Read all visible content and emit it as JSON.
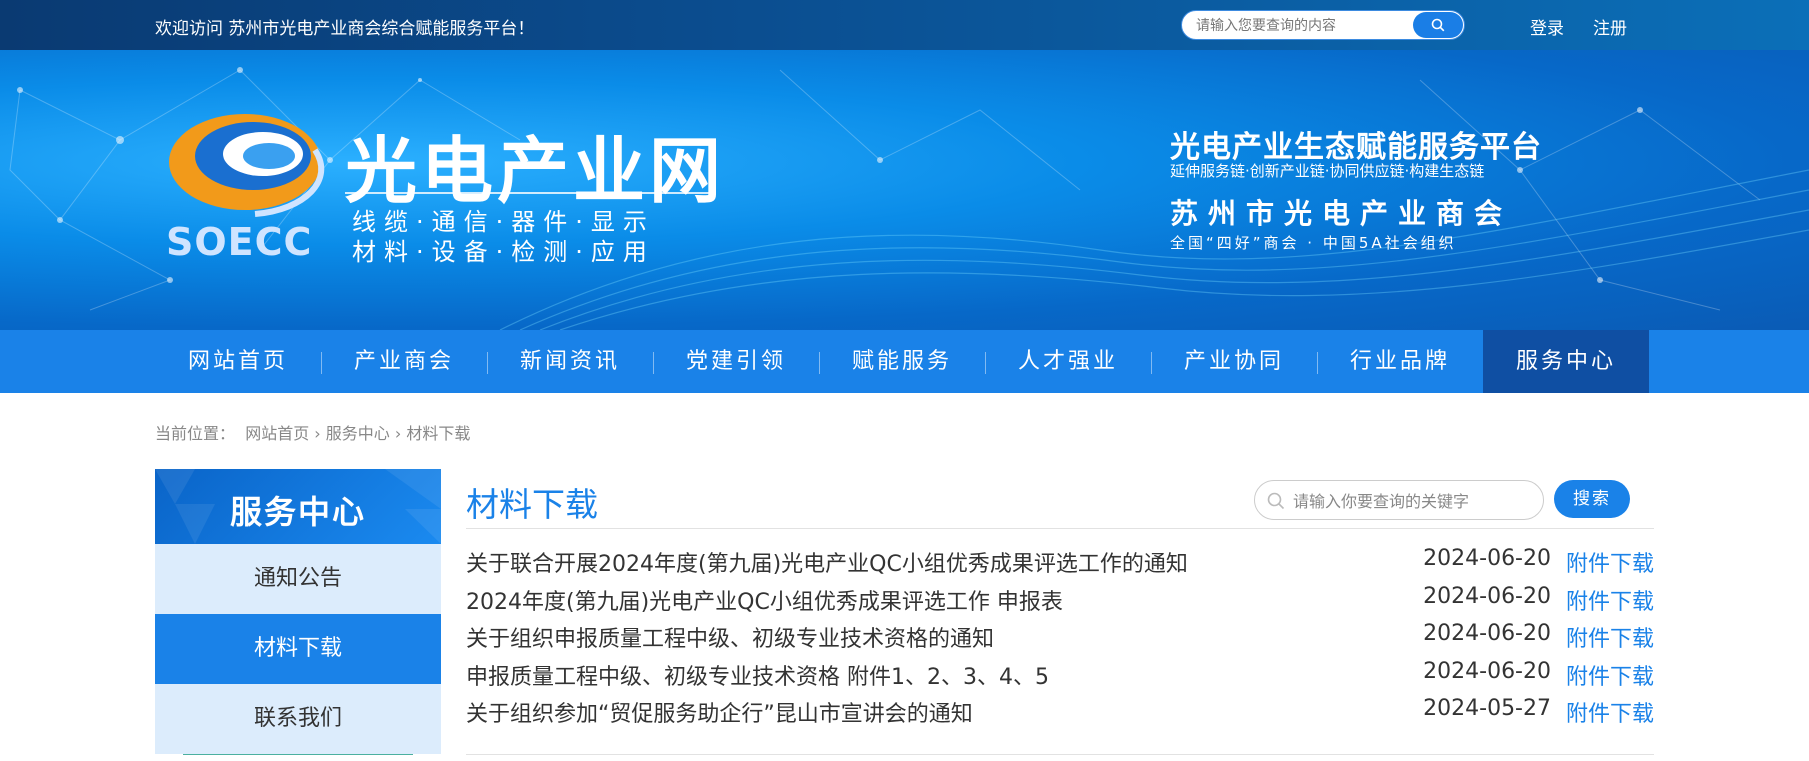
{
  "topbar": {
    "welcome": "欢迎访问  苏州市光电产业商会综合赋能服务平台！",
    "search_placeholder": "请输入您要查询的内容",
    "login": "登录",
    "register": "注册"
  },
  "banner": {
    "logo_title": "光电产业网",
    "logo_line1": "线缆·通信·器件·显示",
    "logo_line2": "材料·设备·检测·应用",
    "logo_abbr": "SOECC",
    "slogan_title": "光电产业生态赋能服务平台",
    "slogan_sub": "延伸服务链·创新产业链·协同供应链·构建生态链",
    "org_name": "苏州市光电产业商会",
    "org_honor": "全国“四好”商会 · 中国5A社会组织"
  },
  "nav": {
    "items": [
      "网站首页",
      "产业商会",
      "新闻资讯",
      "党建引领",
      "赋能服务",
      "人才强业",
      "产业协同",
      "行业品牌",
      "服务中心"
    ],
    "active_index": 8
  },
  "breadcrumb": {
    "label": "当前位置：",
    "path": "网站首页 › 服务中心 › 材料下载"
  },
  "sidebar": {
    "title": "服务中心",
    "items": [
      "通知公告",
      "材料下载",
      "联系我们"
    ],
    "active_index": 1
  },
  "main": {
    "title": "材料下载",
    "search_placeholder": "请输入你要查询的关键字",
    "search_button": "搜索",
    "download_label": "附件下载",
    "rows": [
      {
        "title": "关于联合开展2024年度(第九届)光电产业QC小组优秀成果评选工作的通知",
        "date": "2024-06-20"
      },
      {
        "title": "2024年度(第九届)光电产业QC小组优秀成果评选工作  申报表",
        "date": "2024-06-20"
      },
      {
        "title": "关于组织申报质量工程中级、初级专业技术资格的通知",
        "date": "2024-06-20"
      },
      {
        "title": "申报质量工程中级、初级专业技术资格  附件1、2、3、4、5",
        "date": "2024-06-20"
      },
      {
        "title": "关于组织参加“贸促服务助企行”昆山市宣讲会的通知",
        "date": "2024-05-27"
      }
    ]
  },
  "colors": {
    "primary": "#1a82e8",
    "nav_active": "#0f4fa3",
    "sidebar_bg": "#dcecfc"
  }
}
